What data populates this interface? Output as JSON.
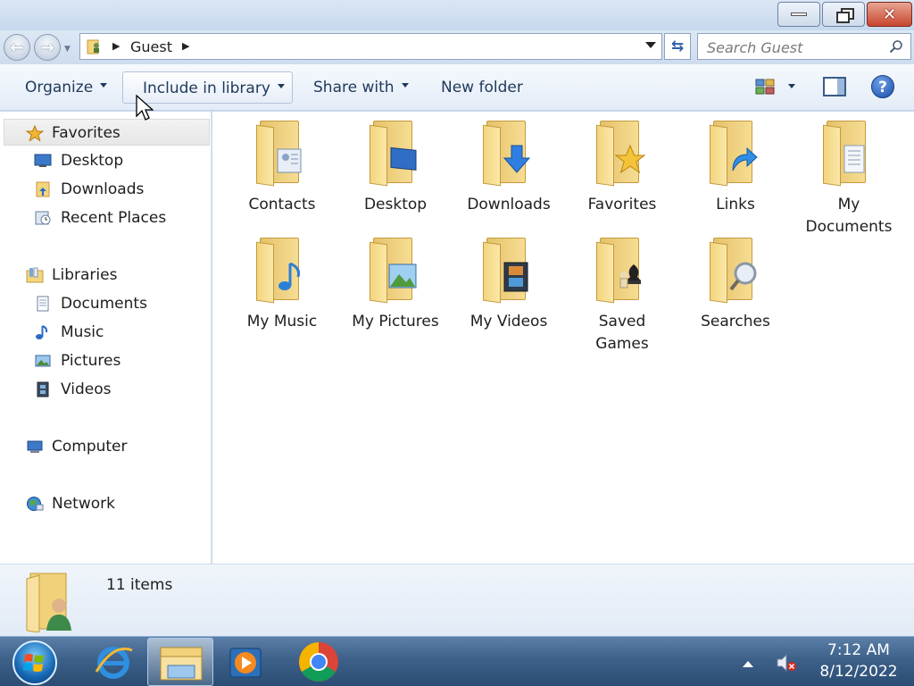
{
  "window": {
    "controls": {
      "minimize": "minimize-icon",
      "maximize": "restore-icon",
      "close": "close-icon"
    }
  },
  "navigation": {
    "address_path": [
      "Guest"
    ],
    "search_placeholder": "Search Guest"
  },
  "toolbar": {
    "organize": "Organize",
    "include_in_library": "Include in library",
    "share_with": "Share with",
    "new_folder": "New folder"
  },
  "sidebar": {
    "favorites": {
      "label": "Favorites",
      "items": [
        "Desktop",
        "Downloads",
        "Recent Places"
      ]
    },
    "libraries": {
      "label": "Libraries",
      "items": [
        "Documents",
        "Music",
        "Pictures",
        "Videos"
      ]
    },
    "computer": "Computer",
    "network": "Network"
  },
  "content": {
    "folders": [
      {
        "name": "Contacts",
        "icon": "contacts-icon"
      },
      {
        "name": "Desktop",
        "icon": "desktop-icon"
      },
      {
        "name": "Downloads",
        "icon": "download-arrow-icon"
      },
      {
        "name": "Favorites",
        "icon": "star-icon"
      },
      {
        "name": "Links",
        "icon": "link-arrow-icon"
      },
      {
        "name": "My Documents",
        "icon": "document-icon"
      },
      {
        "name": "My Music",
        "icon": "music-note-icon"
      },
      {
        "name": "My Pictures",
        "icon": "picture-icon"
      },
      {
        "name": "My Videos",
        "icon": "film-icon"
      },
      {
        "name": "Saved Games",
        "icon": "chess-piece-icon"
      },
      {
        "name": "Searches",
        "icon": "magnifier-icon"
      }
    ]
  },
  "details": {
    "item_count": "11 items"
  },
  "taskbar": {
    "pinned": [
      "internet-explorer-icon",
      "file-explorer-icon",
      "media-player-icon",
      "chrome-icon"
    ],
    "time": "7:12 AM",
    "date": "8/12/2022"
  },
  "colors": {
    "accent": "#1e395b",
    "folder": "#f3d57e",
    "taskbar": "#3d6189"
  }
}
